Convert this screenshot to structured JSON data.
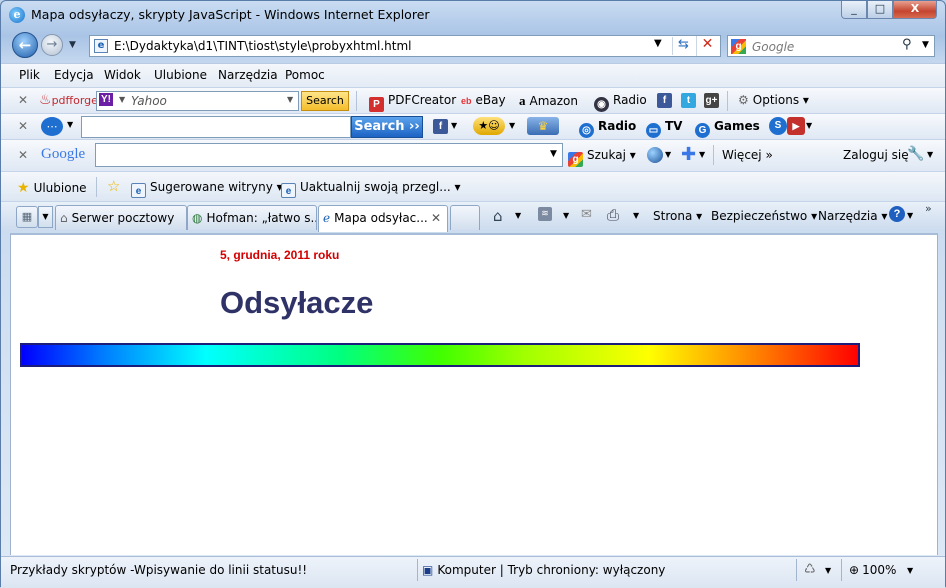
{
  "window": {
    "title": "Mapa odsyłaczy, skrypty JavaScript - Windows Internet Explorer",
    "min": "_",
    "max": "□",
    "close": "X"
  },
  "nav": {
    "address": "E:\\Dydaktyka\\d1\\TINT\\tiost\\style\\probyxhtml.html",
    "search_placeholder": "Google"
  },
  "menu": [
    "Plik",
    "Edycja",
    "Widok",
    "Ulubione",
    "Narzędzia",
    "Pomoc"
  ],
  "toolbar1": {
    "brand": "pdfforge",
    "yahoo_placeholder": "Yahoo",
    "search_btn": "Search",
    "pdfcreator": "PDFCreator",
    "ebay": "eBay",
    "amazon": "Amazon",
    "radio": "Radio",
    "options": "Options"
  },
  "toolbar2": {
    "search_btn": "Search ››",
    "radio": "Radio",
    "tv": "TV",
    "games": "Games"
  },
  "toolbar3": {
    "brand": "Google",
    "szukaj": "Szukaj",
    "wiecej": "Więcej »",
    "zaloguj": "Zaloguj się"
  },
  "favorites": {
    "ulubione": "Ulubione",
    "sugerowane": "Sugerowane witryny",
    "uaktualnij": "Uaktualnij swoją przegl..."
  },
  "tabs": [
    {
      "label": "Serwer pocztowy"
    },
    {
      "label": "Hofman: „łatwo s..."
    },
    {
      "label": "Mapa odsyłac..."
    }
  ],
  "commands": {
    "strona": "Strona",
    "bezpieczenstwo": "Bezpieczeństwo",
    "narzedzia": "Narzędzia"
  },
  "page": {
    "date": "5, grudnia, 2011 roku",
    "heading": "Odsyłacze"
  },
  "status": {
    "message": "Przykłady skryptów -Wpisywanie do linii statusu!!",
    "zone": "Komputer | Tryb chroniony: wyłączony",
    "zoom": "100%"
  }
}
